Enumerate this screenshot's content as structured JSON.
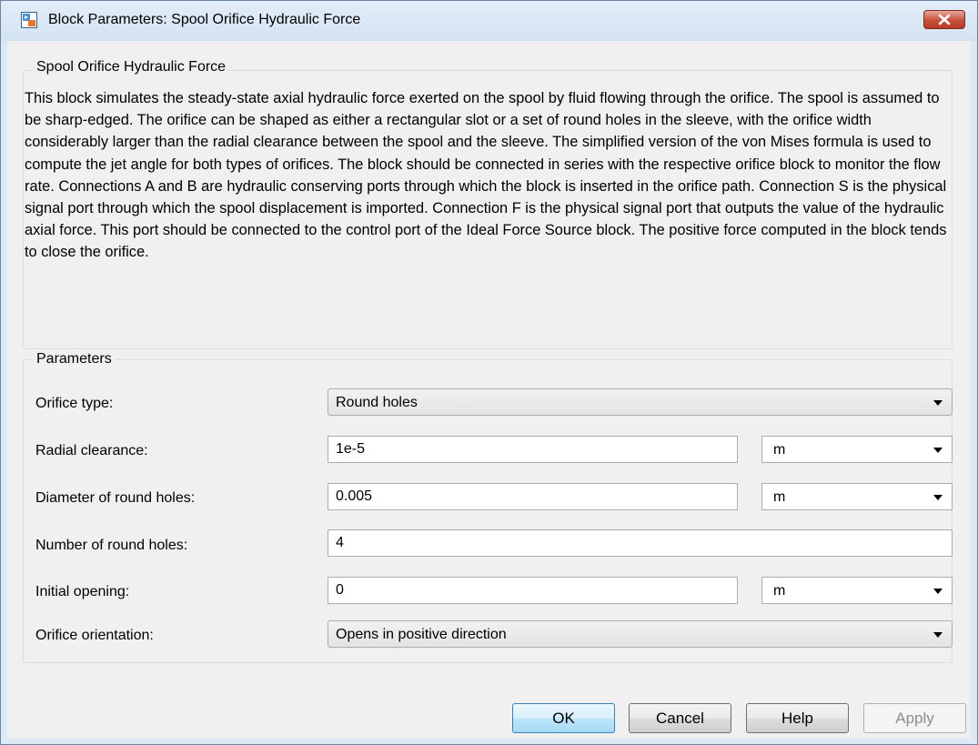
{
  "window": {
    "title": "Block Parameters: Spool Orifice Hydraulic Force",
    "icon": "simulink-block-icon",
    "close_icon": "close-x-icon"
  },
  "description_group": {
    "legend": "Spool Orifice Hydraulic Force",
    "text": "This block simulates the steady-state axial hydraulic force exerted on the spool by fluid flowing through the orifice. The spool is assumed to be sharp-edged. The orifice can be shaped as either a rectangular slot or a set of round holes in the sleeve, with the orifice width considerably larger than the radial clearance between the spool and the sleeve. The simplified version of the von Mises formula is used to compute the jet angle for both types of orifices. The block should be connected in series with the respective orifice block to monitor the flow rate. Connections A and B are hydraulic conserving ports through which the block is inserted in the orifice path. Connection S is the physical signal port through which the spool displacement is imported. Connection F is the physical signal port that outputs the value of the hydraulic axial force. This port should be connected to the control port of the Ideal Force Source block. The positive force computed in the block tends to close the orifice."
  },
  "parameters": {
    "legend": "Parameters",
    "orifice_type": {
      "label": "Orifice type:",
      "value": "Round holes"
    },
    "radial_clearance": {
      "label": "Radial clearance:",
      "value": "1e-5",
      "unit": "m"
    },
    "diameter": {
      "label": "Diameter of round holes:",
      "value": "0.005",
      "unit": "m"
    },
    "num_holes": {
      "label": "Number of round holes:",
      "value": "4"
    },
    "initial_opening": {
      "label": "Initial opening:",
      "value": "0",
      "unit": "m"
    },
    "orientation": {
      "label": "Orifice orientation:",
      "value": "Opens in positive direction"
    }
  },
  "buttons": {
    "ok": "OK",
    "cancel": "Cancel",
    "help": "Help",
    "apply": "Apply"
  }
}
